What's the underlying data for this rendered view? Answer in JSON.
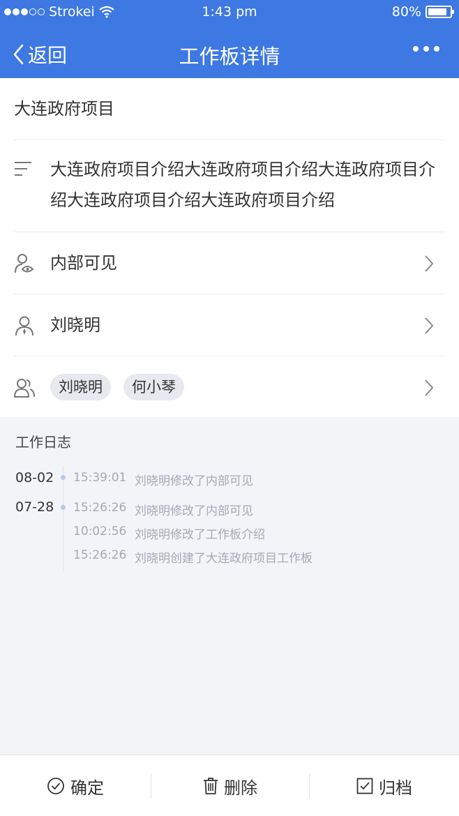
{
  "status_bar": {
    "carrier": "Strokei",
    "time": "1:43 pm",
    "battery": "80%"
  },
  "nav": {
    "back_label": "返回",
    "title": "工作板详情"
  },
  "detail": {
    "project_name": "大连政府项目",
    "description": "大连政府项目介绍大连政府项目介绍大连政府项目介绍大连政府项目介绍大连政府项目介绍",
    "visibility": "内部可见",
    "owner": "刘晓明",
    "members": [
      "刘晓明",
      "何小琴"
    ]
  },
  "log": {
    "title": "工作日志",
    "groups": [
      {
        "date": "08-02",
        "entries": [
          {
            "time": "15:39:01",
            "text": "刘晓明修改了内部可见"
          }
        ]
      },
      {
        "date": "07-28",
        "entries": [
          {
            "time": "15:26:26",
            "text": "刘晓明修改了内部可见"
          },
          {
            "time": "10:02:56",
            "text": "刘晓明修改了工作板介绍"
          },
          {
            "time": "15:26:26",
            "text": "刘晓明创建了大连政府项目工作板"
          }
        ]
      }
    ]
  },
  "actions": {
    "confirm": "确定",
    "delete": "删除",
    "archive": "归档"
  },
  "colors": {
    "accent": "#3d78e3",
    "background": "#f3f4f7",
    "muted_text": "#a5a9b2"
  }
}
